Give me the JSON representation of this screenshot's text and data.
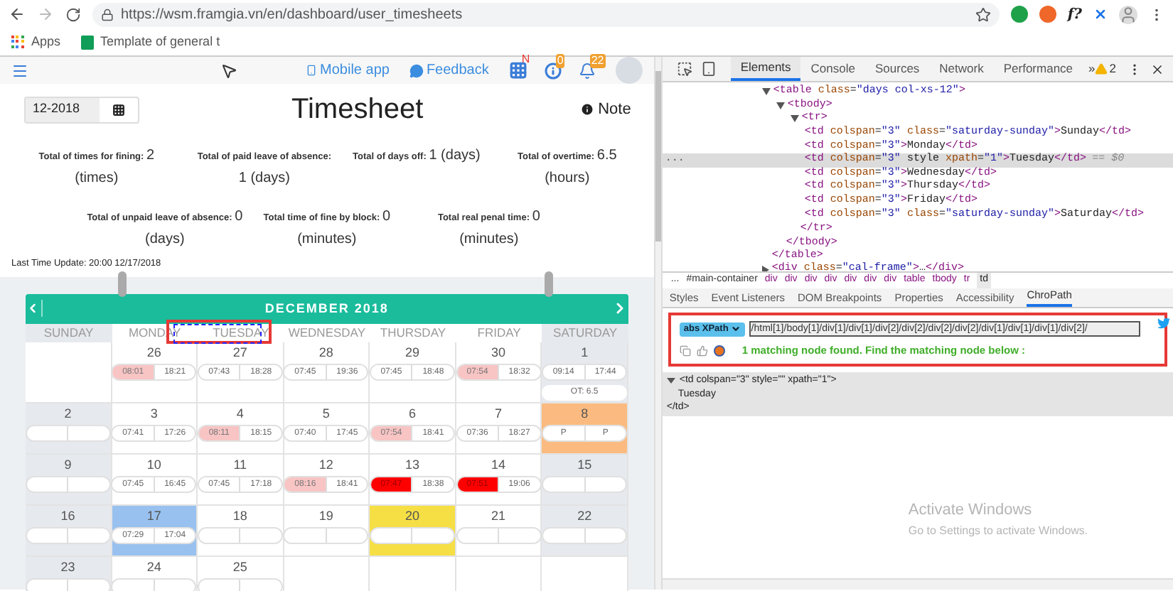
{
  "browser": {
    "url": "https://wsm.framgia.vn/en/dashboard/user_timesheets",
    "extension_text": "f?",
    "bookmarks": [
      {
        "kind": "apps",
        "label": "Apps"
      },
      {
        "kind": "sheet",
        "label": "Template of general t"
      }
    ]
  },
  "header": {
    "links": [
      {
        "kind": "mobile",
        "label": "Mobile app"
      },
      {
        "kind": "feedback",
        "label": "Feedback"
      }
    ],
    "badges": [
      {
        "kind": "grid",
        "label": "N"
      },
      {
        "kind": "info",
        "label": "0"
      },
      {
        "kind": "bell",
        "label": "22"
      }
    ]
  },
  "month_field": {
    "value": "12-2018"
  },
  "title": "Timesheet",
  "note": "Note",
  "stats": [
    {
      "label": "Total of times for fining:",
      "value": "2",
      "unit": "(times)"
    },
    {
      "label": "Total of paid leave of absence:",
      "value": "1",
      "unit": "(days)"
    },
    {
      "label": "Total of days off:",
      "value": "1",
      "unit": "(days)"
    },
    {
      "label": "Total of overtime:",
      "value": "6.5",
      "unit": "(hours)"
    },
    {
      "label": "Total of unpaid leave of absence:",
      "value": "0",
      "unit": "(days)"
    },
    {
      "label": "Total time of fine by block:",
      "value": "0",
      "unit": "(minutes)"
    },
    {
      "label": "Total real penal time:",
      "value": "0",
      "unit": "(minutes)"
    }
  ],
  "last_update": "Last Time Update: 20:00 12/17/2018",
  "calendar": {
    "month": "DECEMBER 2018",
    "days": [
      {
        "label": "SUNDAY",
        "weekend": true
      },
      {
        "label": "MONDAY",
        "weekend": false
      },
      {
        "label": "TUESDAY",
        "weekend": false
      },
      {
        "label": "WEDNESDAY",
        "weekend": false
      },
      {
        "label": "THURSDAY",
        "weekend": false
      },
      {
        "label": "FRIDAY",
        "weekend": false
      },
      {
        "label": "SATURDAY",
        "weekend": true
      }
    ],
    "weeks": [
      [
        {
          "kind": "blank"
        },
        {
          "kind": "normal",
          "day": "26",
          "in": "08:01",
          "out": "18:21",
          "late": true,
          "fined": false
        },
        {
          "kind": "normal",
          "day": "27",
          "in": "07:43",
          "out": "18:28",
          "late": false,
          "fined": false
        },
        {
          "kind": "normal",
          "day": "28",
          "in": "07:45",
          "out": "19:36",
          "late": false,
          "fined": false
        },
        {
          "kind": "normal",
          "day": "29",
          "in": "07:45",
          "out": "18:48",
          "late": false,
          "fined": false
        },
        {
          "kind": "normal",
          "day": "30",
          "in": "07:54",
          "out": "18:32",
          "late": true,
          "fined": false
        },
        {
          "kind": "weekend",
          "day": "1",
          "in": "09:14",
          "out": "17:44",
          "late": false,
          "fined": false,
          "ot": "OT: 6.5"
        }
      ],
      [
        {
          "kind": "weekend",
          "day": "2"
        },
        {
          "kind": "normal",
          "day": "3",
          "in": "07:41",
          "out": "17:26",
          "late": false,
          "fined": false
        },
        {
          "kind": "normal",
          "day": "4",
          "in": "08:11",
          "out": "18:15",
          "late": true,
          "fined": false
        },
        {
          "kind": "normal",
          "day": "5",
          "in": "07:40",
          "out": "17:45",
          "late": false,
          "fined": false
        },
        {
          "kind": "normal",
          "day": "6",
          "in": "07:54",
          "out": "18:41",
          "late": true,
          "fined": false
        },
        {
          "kind": "normal",
          "day": "7",
          "in": "07:36",
          "out": "18:27",
          "late": false,
          "fined": false
        },
        {
          "kind": "leave",
          "day": "8",
          "in": "P",
          "out": "P",
          "late": false,
          "fined": false
        }
      ],
      [
        {
          "kind": "weekend",
          "day": "9"
        },
        {
          "kind": "normal",
          "day": "10",
          "in": "07:45",
          "out": "16:45",
          "late": false,
          "fined": false
        },
        {
          "kind": "normal",
          "day": "11",
          "in": "07:45",
          "out": "17:18",
          "late": false,
          "fined": false
        },
        {
          "kind": "normal",
          "day": "12",
          "in": "08:16",
          "out": "18:41",
          "late": true,
          "fined": false
        },
        {
          "kind": "normal",
          "day": "13",
          "in": "07:47",
          "out": "18:38",
          "late": false,
          "fined": true
        },
        {
          "kind": "normal",
          "day": "14",
          "in": "07:51",
          "out": "19:06",
          "late": false,
          "fined": true
        },
        {
          "kind": "weekend",
          "day": "15"
        }
      ],
      [
        {
          "kind": "weekend",
          "day": "16"
        },
        {
          "kind": "today",
          "day": "17",
          "in": "07:29",
          "out": "17:04",
          "late": false,
          "fined": false
        },
        {
          "kind": "normal",
          "day": "18"
        },
        {
          "kind": "normal",
          "day": "19"
        },
        {
          "kind": "holiday",
          "day": "20"
        },
        {
          "kind": "normal",
          "day": "21"
        },
        {
          "kind": "weekend",
          "day": "22"
        }
      ],
      [
        {
          "kind": "weekend",
          "day": "23"
        },
        {
          "kind": "normal",
          "day": "24"
        },
        {
          "kind": "normal",
          "day": "25"
        },
        {
          "kind": "blank"
        },
        {
          "kind": "blank"
        },
        {
          "kind": "blank"
        },
        {
          "kind": "blank"
        }
      ]
    ]
  },
  "devtools": {
    "tabs": [
      {
        "label": "Elements",
        "selected": true
      },
      {
        "label": "Console",
        "selected": false
      },
      {
        "label": "Sources",
        "selected": false
      },
      {
        "label": "Network",
        "selected": false
      },
      {
        "label": "Performance",
        "selected": false
      }
    ],
    "overflow": "»",
    "warnings": "2",
    "dom": [
      {
        "text": "<table class=\"days col-xs-12\">",
        "expanded": true,
        "selected": false,
        "closing": "</table>",
        "children": [
          {
            "text": "<tbody>",
            "expanded": true,
            "selected": false,
            "closing": "</tbody>",
            "children": [
              {
                "text": "<tr>",
                "expanded": true,
                "selected": false,
                "closing": "</tr>",
                "children": [
                  {
                    "text": "<td colspan=\"3\" class=\"saturday-sunday\">Sunday</td>",
                    "selected": false
                  },
                  {
                    "text": "<td colspan=\"3\">Monday</td>",
                    "selected": false
                  },
                  {
                    "text": "<td colspan=\"3\" style xpath=\"1\">Tuesday</td>",
                    "selected": true,
                    "suffix": "== $0",
                    "gutter": "..."
                  },
                  {
                    "text": "<td colspan=\"3\">Wednesday</td>",
                    "selected": false
                  },
                  {
                    "text": "<td colspan=\"3\">Thursday</td>",
                    "selected": false
                  },
                  {
                    "text": "<td colspan=\"3\">Friday</td>",
                    "selected": false
                  },
                  {
                    "text": "<td colspan=\"3\" class=\"saturday-sunday\">Saturday</td>",
                    "selected": false
                  }
                ]
              }
            ]
          }
        ]
      },
      {
        "text": "<div class=\"cal-frame\">…</div>",
        "expanded": false,
        "selected": false
      }
    ],
    "breadcrumbs": [
      {
        "label": "...",
        "selected": false
      },
      {
        "label": "#main-container",
        "selected": false
      },
      {
        "label": "div",
        "selected": false
      },
      {
        "label": "div",
        "selected": false
      },
      {
        "label": "div",
        "selected": false
      },
      {
        "label": "div",
        "selected": false
      },
      {
        "label": "div",
        "selected": false
      },
      {
        "label": "div",
        "selected": false
      },
      {
        "label": "div",
        "selected": false
      },
      {
        "label": "table",
        "selected": false
      },
      {
        "label": "tbody",
        "selected": false
      },
      {
        "label": "tr",
        "selected": false
      },
      {
        "label": "td",
        "selected": true
      }
    ],
    "subtabs": [
      {
        "label": "Styles",
        "selected": false
      },
      {
        "label": "Event Listeners",
        "selected": false
      },
      {
        "label": "DOM Breakpoints",
        "selected": false
      },
      {
        "label": "Properties",
        "selected": false
      },
      {
        "label": "Accessibility",
        "selected": false
      },
      {
        "label": "ChroPath",
        "selected": true
      }
    ],
    "chropath": {
      "mode": "abs XPath",
      "value": "/html[1]/body[1]/div[1]/div[1]/div[2]/div[2]/div[2]/div[2]/div[1]/div[1]/div[1]/div[2]/",
      "message": "1 matching node found. Find the matching node below :"
    },
    "result": [
      "<td colspan=\"3\" style=\"\" xpath=\"1\">",
      "Tuesday",
      "</td>"
    ]
  },
  "os_notice": {
    "title": "Activate Windows",
    "subtitle": "Go to Settings to activate Windows."
  }
}
